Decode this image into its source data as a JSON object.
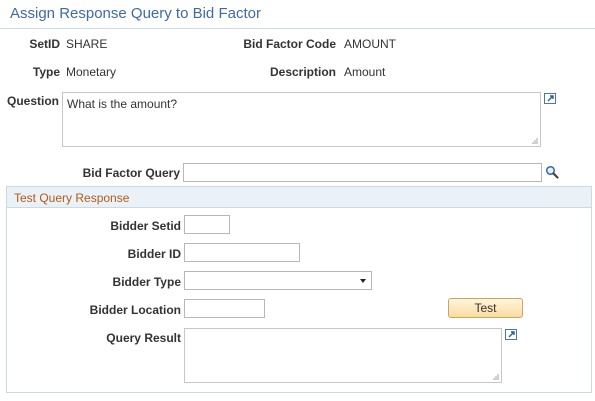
{
  "page": {
    "title": "Assign Response Query to Bid Factor"
  },
  "header": {
    "setid_label": "SetID",
    "setid_value": "SHARE",
    "bid_factor_code_label": "Bid Factor Code",
    "bid_factor_code_value": "AMOUNT",
    "type_label": "Type",
    "type_value": "Monetary",
    "description_label": "Description",
    "description_value": "Amount"
  },
  "question": {
    "label": "Question",
    "value": "What is the amount?"
  },
  "bid_factor_query": {
    "label": "Bid Factor Query",
    "value": ""
  },
  "test_section": {
    "title": "Test Query Response",
    "bidder_setid_label": "Bidder Setid",
    "bidder_setid_value": "",
    "bidder_id_label": "Bidder ID",
    "bidder_id_value": "",
    "bidder_type_label": "Bidder Type",
    "bidder_type_value": "",
    "bidder_location_label": "Bidder Location",
    "bidder_location_value": "",
    "test_button_label": "Test",
    "query_result_label": "Query Result",
    "query_result_value": ""
  },
  "icons": {
    "expand": "expand-textarea-icon",
    "lookup": "magnifier-lookup-icon",
    "resize": "resize-grip-icon"
  },
  "colors": {
    "title": "#3c6ba8",
    "section_title": "#b05a18",
    "section_header_bg": "#eaf2f8",
    "button_bg": "#fbdca0"
  }
}
